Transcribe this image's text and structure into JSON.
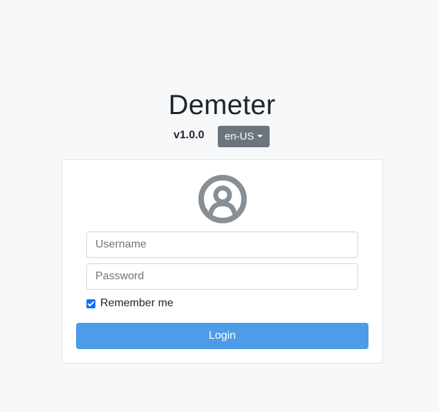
{
  "header": {
    "app_title": "Demeter",
    "version": "v1.0.0",
    "language": "en-US"
  },
  "login_form": {
    "avatar_icon": "user-circle-icon",
    "username_placeholder": "Username",
    "username_value": "",
    "password_placeholder": "Password",
    "password_value": "",
    "remember_label": "Remember me",
    "remember_checked": true,
    "login_label": "Login"
  },
  "colors": {
    "background": "#f7f8fa",
    "language_button": "#6c757d",
    "avatar": "#868e96",
    "checkbox": "#0d6efd",
    "login_button": "#4e9be7"
  }
}
